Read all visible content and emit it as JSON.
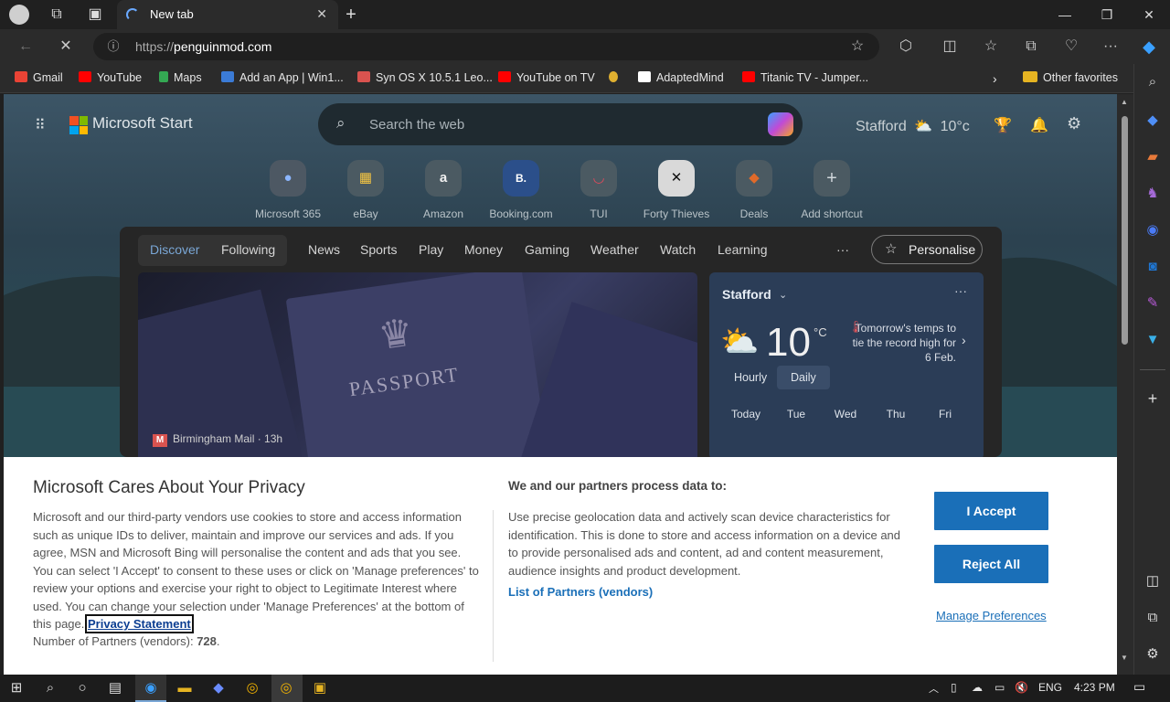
{
  "browser": {
    "tab_title": "New tab",
    "url_prefix": "https://",
    "url_domain": "penguinmod.com"
  },
  "favorites": [
    {
      "label": "Gmail",
      "color": "#ea4335"
    },
    {
      "label": "YouTube",
      "color": "#ff0000"
    },
    {
      "label": "Maps",
      "color": "#34a853"
    },
    {
      "label": "Add an App | Win1...",
      "color": "#3b7bd6"
    },
    {
      "label": "Syn OS X 10.5.1 Leo...",
      "color": "#d9534f"
    },
    {
      "label": "YouTube on TV",
      "color": "#ff0000"
    },
    {
      "label": "",
      "color": "#e0b030"
    },
    {
      "label": "AdaptedMind",
      "color": "#ffffff"
    },
    {
      "label": "Titanic TV - Jumper...",
      "color": "#ff0000"
    },
    {
      "label": "Other favorites",
      "color": "#e6b422"
    }
  ],
  "start": {
    "brand": "Microsoft Start",
    "search_placeholder": "Search the web",
    "weather_city": "Stafford",
    "weather_temp": "10°c",
    "shortcuts": [
      {
        "label": "Microsoft 365",
        "icon": "m365-icon"
      },
      {
        "label": "eBay",
        "icon": "ebay-icon"
      },
      {
        "label": "Amazon",
        "icon": "amazon-icon"
      },
      {
        "label": "Booking.com",
        "icon": "booking-icon"
      },
      {
        "label": "TUI",
        "icon": "tui-icon"
      },
      {
        "label": "Forty Thieves",
        "icon": "forty-thieves-icon"
      },
      {
        "label": "Deals",
        "icon": "deals-icon"
      },
      {
        "label": "Add shortcut",
        "icon": "plus-icon"
      }
    ],
    "feed_tabs": [
      "Discover",
      "Following",
      "News",
      "Sports",
      "Play",
      "Money",
      "Gaming",
      "Weather",
      "Watch",
      "Learning"
    ],
    "more": "···",
    "personalise": "Personalise",
    "hero": {
      "source": "Birmingham Mail · 13h",
      "passport_text": "PASSPORT"
    },
    "weather_card": {
      "city": "Stafford",
      "temp": "10",
      "unit": "°C",
      "note": "Tomorrow's temps to tie the record high for 6 Feb.",
      "hourly": "Hourly",
      "daily": "Daily",
      "days": [
        "Today",
        "Tue",
        "Wed",
        "Thu",
        "Fri"
      ]
    }
  },
  "cookie": {
    "title": "Microsoft Cares About Your Privacy",
    "body": "Microsoft and our third-party vendors use cookies to store and access information such as unique IDs to deliver, maintain and improve our services and ads. If you agree, MSN and Microsoft Bing will personalise the content and ads that you see. You can select 'I Accept' to consent to these uses or click on 'Manage preferences' to review your options and exercise your right to object to Legitimate Interest where used.  You can change your selection under 'Manage Preferences' at the bottom of this page.",
    "privacy_link": "Privacy Statement",
    "partners_label": "Number of Partners (vendors): ",
    "partners_count": "728",
    "partners_end": ".",
    "process_title": "We and our partners process data to:",
    "process_body": "Use precise geolocation data and actively scan device characteristics for identification. This is done to store and access information on a device and to provide personalised ads and content, ad and content measurement, audience insights and product development.",
    "list_link": "List of Partners (vendors)",
    "accept": "I Accept",
    "reject": "Reject All",
    "manage": "Manage Preferences"
  },
  "taskbar": {
    "lang": "ENG",
    "time": "4:23 PM"
  }
}
